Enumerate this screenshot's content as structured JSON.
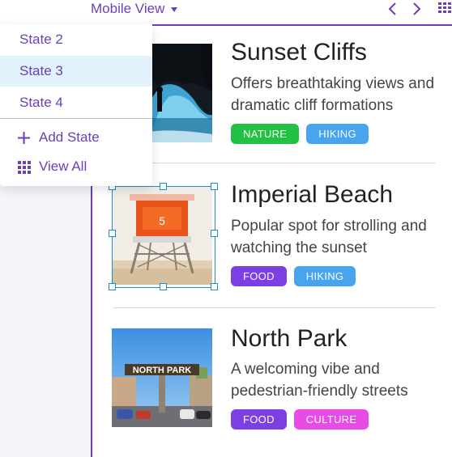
{
  "header": {
    "view_label": "Mobile View"
  },
  "state_menu": {
    "items": [
      {
        "label": "State 2",
        "selected": false
      },
      {
        "label": "State 3",
        "selected": true
      },
      {
        "label": "State 4",
        "selected": false
      }
    ],
    "add_label": "Add State",
    "view_all_label": "View All"
  },
  "cards": [
    {
      "title": "Sunset Cliffs",
      "description": "Offers breathtaking views and dramatic cliff formations",
      "tags": [
        {
          "label": "NATURE",
          "color": "#22c043"
        },
        {
          "label": "HIKING",
          "color": "#48a4ec"
        }
      ]
    },
    {
      "title": "Imperial Beach",
      "description": "Popular spot for strolling and watching the sunset",
      "tower_number": "5",
      "tags": [
        {
          "label": "FOOD",
          "color": "#7b3fe4"
        },
        {
          "label": "HIKING",
          "color": "#48a4ec"
        }
      ]
    },
    {
      "title": "North Park",
      "description": "A welcoming vibe and pedestrian-friendly streets",
      "sign_text": "NORTH PARK",
      "tags": [
        {
          "label": "FOOD",
          "color": "#7b3fe4"
        },
        {
          "label": "CULTURE",
          "color": "#e84be6"
        }
      ]
    }
  ],
  "colors": {
    "accent": "#6a3fb8",
    "selection": "#1a8fc4",
    "menu_selected_bg": "#e2f2fb"
  }
}
